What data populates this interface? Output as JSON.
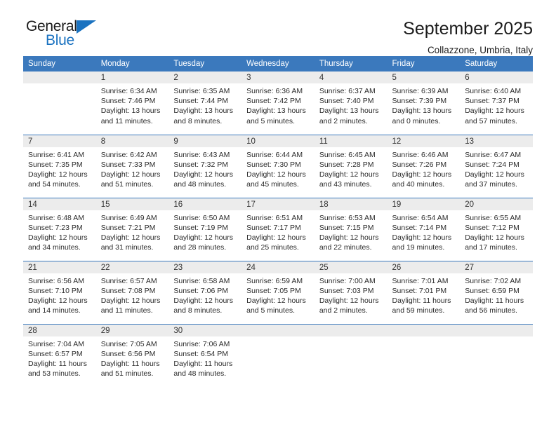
{
  "brand": {
    "name_top": "General",
    "name_bottom": "Blue",
    "accent_color": "#1a72c0"
  },
  "header": {
    "title": "September 2025",
    "subtitle": "Collazzone, Umbria, Italy"
  },
  "theme": {
    "header_blue": "#3b79bd",
    "daynum_band": "#ececec",
    "text": "#2b2b2b"
  },
  "weekday_headers": [
    "Sunday",
    "Monday",
    "Tuesday",
    "Wednesday",
    "Thursday",
    "Friday",
    "Saturday"
  ],
  "labels": {
    "sunrise": "Sunrise:",
    "sunset": "Sunset:",
    "daylight": "Daylight:"
  },
  "weeks": [
    [
      {
        "day": "",
        "empty": true,
        "sunrise": "",
        "sunset": "",
        "daylight1": "",
        "daylight2": ""
      },
      {
        "day": "1",
        "sunrise": "Sunrise: 6:34 AM",
        "sunset": "Sunset: 7:46 PM",
        "daylight1": "Daylight: 13 hours",
        "daylight2": "and 11 minutes."
      },
      {
        "day": "2",
        "sunrise": "Sunrise: 6:35 AM",
        "sunset": "Sunset: 7:44 PM",
        "daylight1": "Daylight: 13 hours",
        "daylight2": "and 8 minutes."
      },
      {
        "day": "3",
        "sunrise": "Sunrise: 6:36 AM",
        "sunset": "Sunset: 7:42 PM",
        "daylight1": "Daylight: 13 hours",
        "daylight2": "and 5 minutes."
      },
      {
        "day": "4",
        "sunrise": "Sunrise: 6:37 AM",
        "sunset": "Sunset: 7:40 PM",
        "daylight1": "Daylight: 13 hours",
        "daylight2": "and 2 minutes."
      },
      {
        "day": "5",
        "sunrise": "Sunrise: 6:39 AM",
        "sunset": "Sunset: 7:39 PM",
        "daylight1": "Daylight: 13 hours",
        "daylight2": "and 0 minutes."
      },
      {
        "day": "6",
        "sunrise": "Sunrise: 6:40 AM",
        "sunset": "Sunset: 7:37 PM",
        "daylight1": "Daylight: 12 hours",
        "daylight2": "and 57 minutes."
      }
    ],
    [
      {
        "day": "7",
        "sunrise": "Sunrise: 6:41 AM",
        "sunset": "Sunset: 7:35 PM",
        "daylight1": "Daylight: 12 hours",
        "daylight2": "and 54 minutes."
      },
      {
        "day": "8",
        "sunrise": "Sunrise: 6:42 AM",
        "sunset": "Sunset: 7:33 PM",
        "daylight1": "Daylight: 12 hours",
        "daylight2": "and 51 minutes."
      },
      {
        "day": "9",
        "sunrise": "Sunrise: 6:43 AM",
        "sunset": "Sunset: 7:32 PM",
        "daylight1": "Daylight: 12 hours",
        "daylight2": "and 48 minutes."
      },
      {
        "day": "10",
        "sunrise": "Sunrise: 6:44 AM",
        "sunset": "Sunset: 7:30 PM",
        "daylight1": "Daylight: 12 hours",
        "daylight2": "and 45 minutes."
      },
      {
        "day": "11",
        "sunrise": "Sunrise: 6:45 AM",
        "sunset": "Sunset: 7:28 PM",
        "daylight1": "Daylight: 12 hours",
        "daylight2": "and 43 minutes."
      },
      {
        "day": "12",
        "sunrise": "Sunrise: 6:46 AM",
        "sunset": "Sunset: 7:26 PM",
        "daylight1": "Daylight: 12 hours",
        "daylight2": "and 40 minutes."
      },
      {
        "day": "13",
        "sunrise": "Sunrise: 6:47 AM",
        "sunset": "Sunset: 7:24 PM",
        "daylight1": "Daylight: 12 hours",
        "daylight2": "and 37 minutes."
      }
    ],
    [
      {
        "day": "14",
        "sunrise": "Sunrise: 6:48 AM",
        "sunset": "Sunset: 7:23 PM",
        "daylight1": "Daylight: 12 hours",
        "daylight2": "and 34 minutes."
      },
      {
        "day": "15",
        "sunrise": "Sunrise: 6:49 AM",
        "sunset": "Sunset: 7:21 PM",
        "daylight1": "Daylight: 12 hours",
        "daylight2": "and 31 minutes."
      },
      {
        "day": "16",
        "sunrise": "Sunrise: 6:50 AM",
        "sunset": "Sunset: 7:19 PM",
        "daylight1": "Daylight: 12 hours",
        "daylight2": "and 28 minutes."
      },
      {
        "day": "17",
        "sunrise": "Sunrise: 6:51 AM",
        "sunset": "Sunset: 7:17 PM",
        "daylight1": "Daylight: 12 hours",
        "daylight2": "and 25 minutes."
      },
      {
        "day": "18",
        "sunrise": "Sunrise: 6:53 AM",
        "sunset": "Sunset: 7:15 PM",
        "daylight1": "Daylight: 12 hours",
        "daylight2": "and 22 minutes."
      },
      {
        "day": "19",
        "sunrise": "Sunrise: 6:54 AM",
        "sunset": "Sunset: 7:14 PM",
        "daylight1": "Daylight: 12 hours",
        "daylight2": "and 19 minutes."
      },
      {
        "day": "20",
        "sunrise": "Sunrise: 6:55 AM",
        "sunset": "Sunset: 7:12 PM",
        "daylight1": "Daylight: 12 hours",
        "daylight2": "and 17 minutes."
      }
    ],
    [
      {
        "day": "21",
        "sunrise": "Sunrise: 6:56 AM",
        "sunset": "Sunset: 7:10 PM",
        "daylight1": "Daylight: 12 hours",
        "daylight2": "and 14 minutes."
      },
      {
        "day": "22",
        "sunrise": "Sunrise: 6:57 AM",
        "sunset": "Sunset: 7:08 PM",
        "daylight1": "Daylight: 12 hours",
        "daylight2": "and 11 minutes."
      },
      {
        "day": "23",
        "sunrise": "Sunrise: 6:58 AM",
        "sunset": "Sunset: 7:06 PM",
        "daylight1": "Daylight: 12 hours",
        "daylight2": "and 8 minutes."
      },
      {
        "day": "24",
        "sunrise": "Sunrise: 6:59 AM",
        "sunset": "Sunset: 7:05 PM",
        "daylight1": "Daylight: 12 hours",
        "daylight2": "and 5 minutes."
      },
      {
        "day": "25",
        "sunrise": "Sunrise: 7:00 AM",
        "sunset": "Sunset: 7:03 PM",
        "daylight1": "Daylight: 12 hours",
        "daylight2": "and 2 minutes."
      },
      {
        "day": "26",
        "sunrise": "Sunrise: 7:01 AM",
        "sunset": "Sunset: 7:01 PM",
        "daylight1": "Daylight: 11 hours",
        "daylight2": "and 59 minutes."
      },
      {
        "day": "27",
        "sunrise": "Sunrise: 7:02 AM",
        "sunset": "Sunset: 6:59 PM",
        "daylight1": "Daylight: 11 hours",
        "daylight2": "and 56 minutes."
      }
    ],
    [
      {
        "day": "28",
        "sunrise": "Sunrise: 7:04 AM",
        "sunset": "Sunset: 6:57 PM",
        "daylight1": "Daylight: 11 hours",
        "daylight2": "and 53 minutes."
      },
      {
        "day": "29",
        "sunrise": "Sunrise: 7:05 AM",
        "sunset": "Sunset: 6:56 PM",
        "daylight1": "Daylight: 11 hours",
        "daylight2": "and 51 minutes."
      },
      {
        "day": "30",
        "sunrise": "Sunrise: 7:06 AM",
        "sunset": "Sunset: 6:54 PM",
        "daylight1": "Daylight: 11 hours",
        "daylight2": "and 48 minutes."
      },
      {
        "day": "",
        "empty": true,
        "sunrise": "",
        "sunset": "",
        "daylight1": "",
        "daylight2": ""
      },
      {
        "day": "",
        "empty": true,
        "sunrise": "",
        "sunset": "",
        "daylight1": "",
        "daylight2": ""
      },
      {
        "day": "",
        "empty": true,
        "sunrise": "",
        "sunset": "",
        "daylight1": "",
        "daylight2": ""
      },
      {
        "day": "",
        "empty": true,
        "sunrise": "",
        "sunset": "",
        "daylight1": "",
        "daylight2": ""
      }
    ]
  ]
}
